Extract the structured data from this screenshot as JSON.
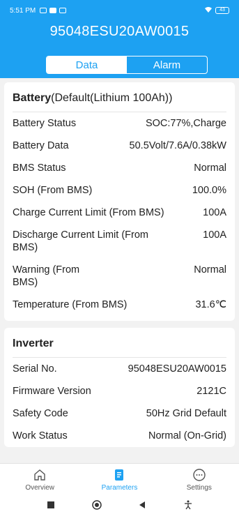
{
  "statusbar": {
    "time": "5:51 PM",
    "battery": "43"
  },
  "header": {
    "title": "95048ESU20AW0015"
  },
  "tabs": [
    {
      "label": "Data"
    },
    {
      "label": "Alarm"
    }
  ],
  "battery_card": {
    "title_bold": "Battery",
    "title_rest": "(Default(Lithium 100Ah))",
    "rows": [
      {
        "label": "Battery Status",
        "value": "SOC:77%,Charge"
      },
      {
        "label": "Battery Data",
        "value": "50.5Volt/7.6A/0.38kW"
      },
      {
        "label": "BMS Status",
        "value": "Normal"
      },
      {
        "label": "SOH (From BMS)",
        "value": "100.0%"
      },
      {
        "label": "Charge Current Limit (From BMS)",
        "value": "100A"
      },
      {
        "label": "Discharge Current Limit (From BMS)",
        "value": "100A"
      },
      {
        "label": "Warning (From BMS)",
        "value": "Normal"
      },
      {
        "label": "Temperature (From BMS)",
        "value": "31.6℃"
      }
    ]
  },
  "inverter_card": {
    "title": "Inverter",
    "rows": [
      {
        "label": "Serial No.",
        "value": "95048ESU20AW0015"
      },
      {
        "label": "Firmware Version",
        "value": "2121C"
      },
      {
        "label": "Safety Code",
        "value": "50Hz Grid Default"
      },
      {
        "label": "Work Status",
        "value": "Normal (On-Grid)"
      }
    ]
  },
  "bottom_nav": [
    {
      "label": "Overview",
      "icon": "home-icon"
    },
    {
      "label": "Parameters",
      "icon": "document-icon"
    },
    {
      "label": "Settings",
      "icon": "more-icon"
    }
  ],
  "colors": {
    "accent": "#1da1f2"
  }
}
